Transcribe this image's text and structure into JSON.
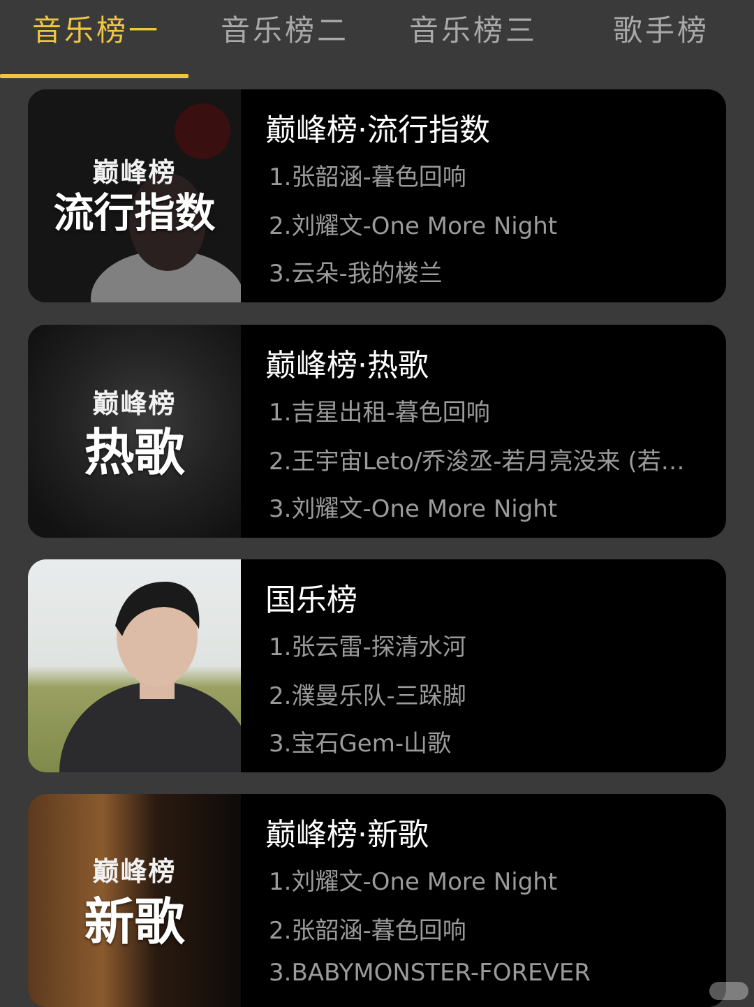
{
  "tabs": [
    {
      "label": "音乐榜一",
      "active": true
    },
    {
      "label": "音乐榜二",
      "active": false
    },
    {
      "label": "音乐榜三",
      "active": false
    },
    {
      "label": "歌手榜",
      "active": false
    }
  ],
  "colors": {
    "accent": "#f0c542",
    "background": "#3a3a3a",
    "card": "#000000"
  },
  "cards": [
    {
      "title": "巅峰榜·流行指数",
      "cover_logo": "巅峰榜",
      "cover_title": "流行指数",
      "tracks": [
        "1.张韶涵-暮色回响",
        "2.刘耀文-One More Night",
        "3.云朵-我的楼兰"
      ]
    },
    {
      "title": "巅峰榜·热歌",
      "cover_logo": "巅峰榜",
      "cover_title": "热歌",
      "tracks": [
        "1.吉星出租-暮色回响",
        "2.王宇宙Leto/乔浚丞-若月亮没来 (若…",
        "3.刘耀文-One More Night"
      ]
    },
    {
      "title": "国乐榜",
      "cover_logo": "",
      "cover_title": "",
      "tracks": [
        "1.张云雷-探清水河",
        "2.濮曼乐队-三跺脚",
        "3.宝石Gem-山歌"
      ]
    },
    {
      "title": "巅峰榜·新歌",
      "cover_logo": "巅峰榜",
      "cover_title": "新歌",
      "tracks": [
        "1.刘耀文-One More Night",
        "2.张韶涵-暮色回响",
        "3.BABYMONSTER-FOREVER"
      ]
    }
  ]
}
